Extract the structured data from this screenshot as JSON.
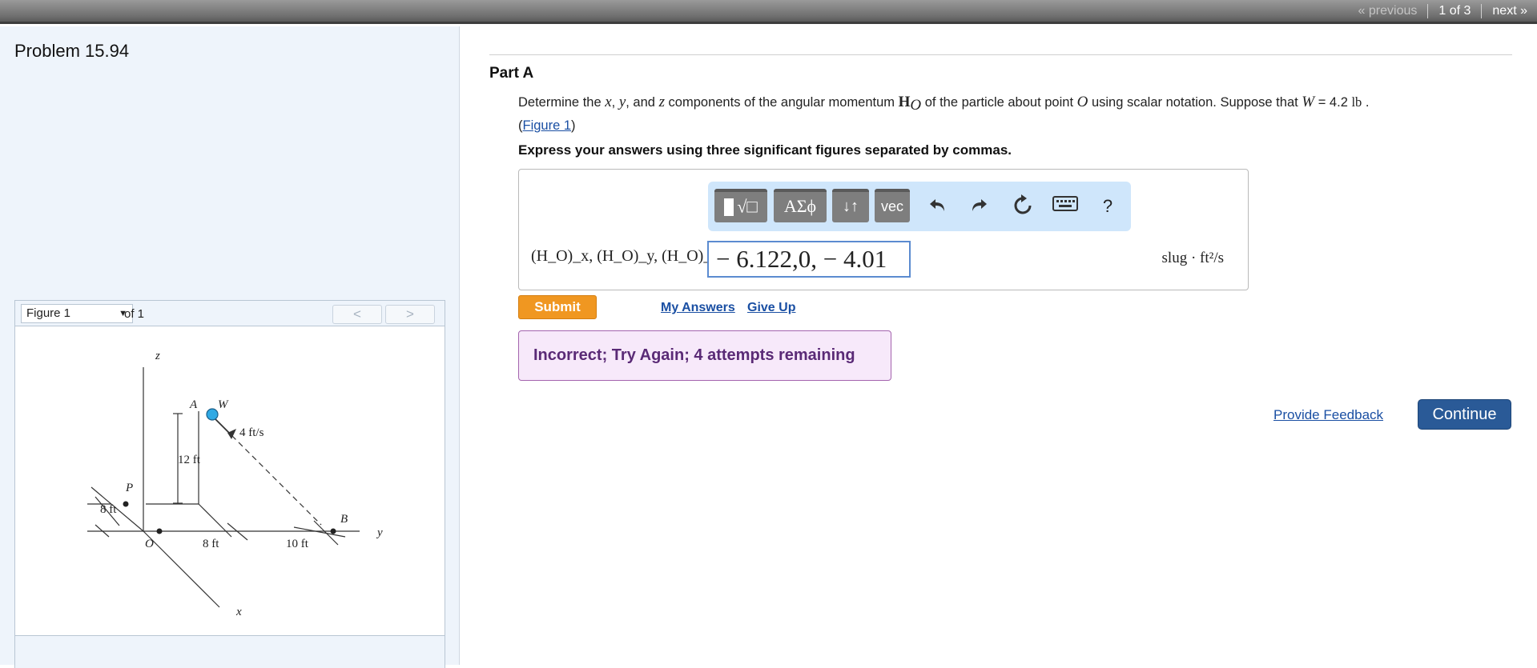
{
  "topnav": {
    "previous": "« previous",
    "count": "1 of 3",
    "next": "next »"
  },
  "left": {
    "problem_title": "Problem 15.94",
    "figure": {
      "select_value": "Figure 1",
      "of_label": "of 1",
      "prev_glyph": "<",
      "next_glyph": ">",
      "labels": {
        "z": "z",
        "A": "A",
        "W": "W",
        "speed": "4 ft/s",
        "height": "12 ft",
        "P": "P",
        "left_dim": "8 ft",
        "O": "O",
        "mid_dim": "8 ft",
        "right_dim": "10 ft",
        "B": "B",
        "y": "y",
        "x": "x"
      }
    }
  },
  "part": {
    "title": "Part A",
    "question": {
      "t1": "Determine the ",
      "x": "x",
      "t2": ", ",
      "y": "y",
      "t3": ", and ",
      "z": "z",
      "t4": " components of the angular momentum ",
      "H": "H",
      "O_sub": "O",
      "t5": " of the particle about point ",
      "O": "O",
      "t6": " using scalar notation. Suppose that ",
      "W": "W",
      "t7": " = 4.2 ",
      "unit": "lb",
      "t8": " .",
      "open_paren": "(",
      "figure_link": "Figure 1",
      "close_paren": ")"
    },
    "instructions": "Express your answers using three significant figures separated by commas.",
    "toolbar": {
      "greek": "ΑΣϕ",
      "arrows": "↓↑",
      "vec": "vec",
      "undo_icon": "undo-icon",
      "redo_icon": "redo-icon",
      "reset_icon": "reset-icon",
      "keyboard_icon": "keyboard-icon",
      "help": "?"
    },
    "answer": {
      "label": "(H_O)_x, (H_O)_y, (H_O)_z =",
      "value": "− 6.122,0, − 4.01",
      "units": "slug · ft²/s"
    },
    "submit": "Submit",
    "my_answers": "My Answers",
    "give_up": "Give Up",
    "feedback": "Incorrect; Try Again; 4 attempts remaining",
    "provide_feedback": "Provide Feedback",
    "continue": "Continue"
  },
  "colors": {
    "submit": "#f09721",
    "continue": "#2a5a97",
    "link": "#1a4fa3",
    "feedback_bg": "#f7e9fa",
    "feedback_text": "#5a2a76",
    "toolbar_bg": "#cfe6fb"
  }
}
